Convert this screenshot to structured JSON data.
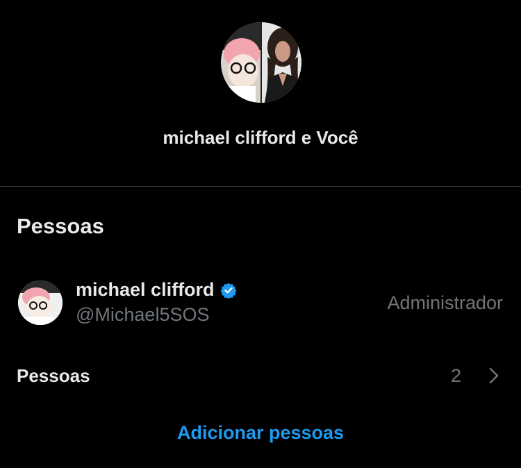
{
  "header": {
    "group_title": "michael clifford e Você"
  },
  "people_section": {
    "title": "Pessoas",
    "members": [
      {
        "name": "michael clifford",
        "handle": "@Michael5SOS",
        "role": "Administrador",
        "verified": true
      }
    ],
    "people_row": {
      "label": "Pessoas",
      "count": "2"
    },
    "add_people_label": "Adicionar pessoas"
  },
  "colors": {
    "background": "#000000",
    "text_primary": "#e7e9ea",
    "text_secondary": "#71767b",
    "accent": "#1d9bf0",
    "divider": "#333639"
  },
  "icons": {
    "verified": "verified-badge-icon",
    "chevron": "chevron-right-icon"
  }
}
